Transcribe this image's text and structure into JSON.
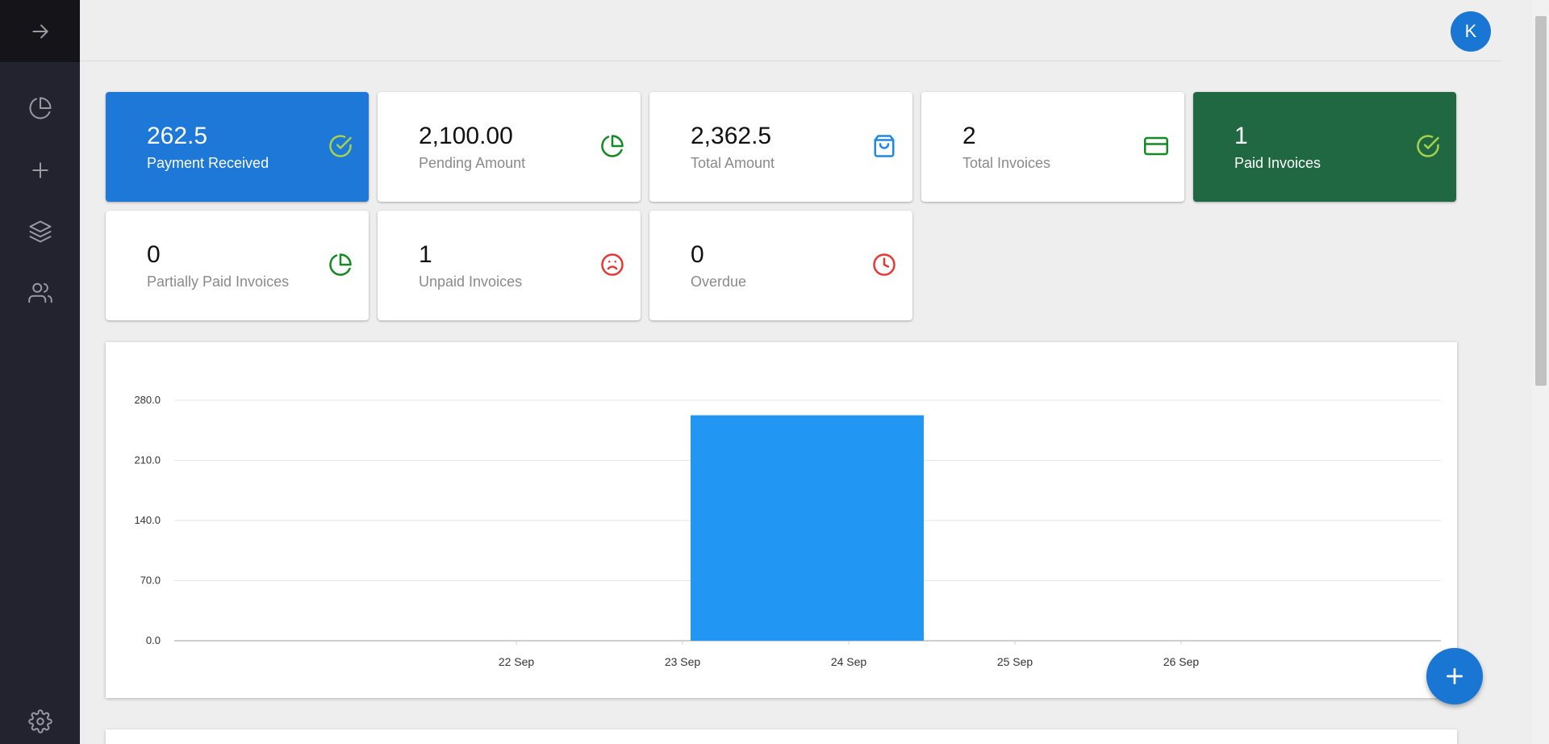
{
  "header": {
    "avatar_initial": "K"
  },
  "sidebar": {
    "items": [
      {
        "icon": "arrow-right-icon"
      },
      {
        "icon": "pie-chart-icon"
      },
      {
        "icon": "plus-icon"
      },
      {
        "icon": "layers-icon"
      },
      {
        "icon": "users-icon"
      },
      {
        "icon": "gear-icon"
      }
    ]
  },
  "cards": [
    {
      "value": "262.5",
      "label": "Payment Received",
      "icon": "check-circle-icon",
      "style": "blue",
      "icon_color": "#a5d24b"
    },
    {
      "value": "2,100.00",
      "label": "Pending Amount",
      "icon": "pie-chart-icon",
      "style": "white",
      "icon_color": "#138a24"
    },
    {
      "value": "2,362.5",
      "label": "Total Amount",
      "icon": "shopping-bag-icon",
      "style": "white",
      "icon_color": "#1e88e5"
    },
    {
      "value": "2",
      "label": "Total Invoices",
      "icon": "credit-card-icon",
      "style": "white",
      "icon_color": "#138a24"
    },
    {
      "value": "1",
      "label": "Paid Invoices",
      "icon": "check-circle-icon",
      "style": "green",
      "icon_color": "#a5d24b"
    },
    {
      "value": "0",
      "label": "Partially Paid Invoices",
      "icon": "pie-chart-icon",
      "style": "white",
      "icon_color": "#138a24"
    },
    {
      "value": "1",
      "label": "Unpaid Invoices",
      "icon": "sad-face-icon",
      "style": "white",
      "icon_color": "#e53935"
    },
    {
      "value": "0",
      "label": "Overdue",
      "icon": "clock-icon",
      "style": "white",
      "icon_color": "#e53935"
    }
  ],
  "chart_data": {
    "type": "bar",
    "categories": [
      "22 Sep",
      "23 Sep",
      "24 Sep",
      "25 Sep",
      "26 Sep"
    ],
    "bar": {
      "from": "23 Sep",
      "to": "24 Sep",
      "value": 262.5
    },
    "y_ticks": [
      "0.0",
      "70.0",
      "140.0",
      "210.0",
      "280.0"
    ],
    "ylim": [
      0,
      280
    ],
    "grid": true,
    "bar_color": "#2196f3"
  },
  "fab": {
    "icon": "plus-icon"
  }
}
